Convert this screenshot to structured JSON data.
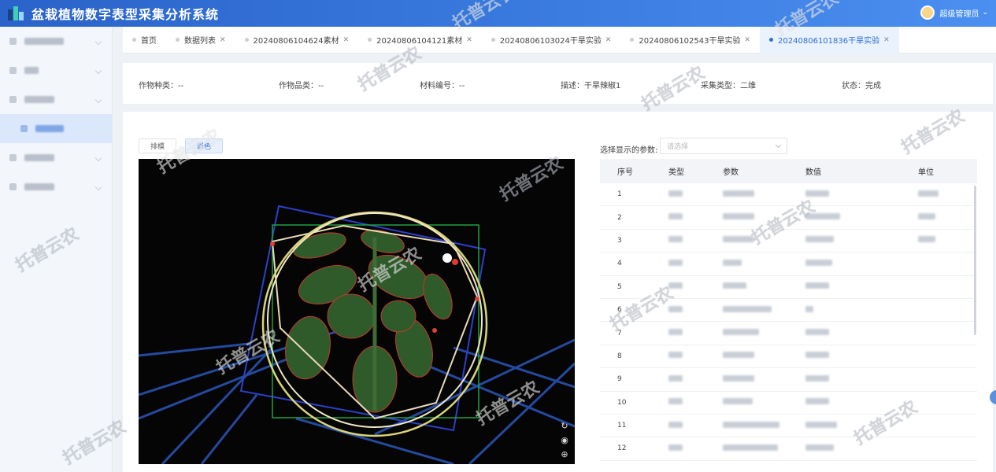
{
  "app": {
    "title": "盆栽植物数字表型采集分析系统",
    "user": "超级管理员"
  },
  "sidebar": {
    "items": [
      {
        "id": "s1",
        "w": 50
      },
      {
        "id": "s2",
        "w": 18
      },
      {
        "id": "s3",
        "w": 38
      },
      {
        "id": "s4",
        "w": 36,
        "active": true
      },
      {
        "id": "s5",
        "w": 38
      },
      {
        "id": "s6",
        "w": 38
      }
    ]
  },
  "tabs": [
    {
      "label": "首页",
      "closable": false
    },
    {
      "label": "数据列表",
      "closable": true
    },
    {
      "label": "20240806104624素材",
      "closable": true
    },
    {
      "label": "20240806104121素材",
      "closable": true
    },
    {
      "label": "20240806103024干旱实验",
      "closable": true
    },
    {
      "label": "20240806102543干旱实验",
      "closable": true
    },
    {
      "label": "20240806101836干旱实验",
      "closable": true,
      "active": true
    }
  ],
  "info": {
    "species": "作物种类：--",
    "variety": "作物品类：--",
    "material": "材料编号：--",
    "desc": "描述：干旱辣椒1",
    "type": "采集类型：二维",
    "status": "状态：完成"
  },
  "buttons": {
    "btn1": "排模",
    "btn2": "彩色"
  },
  "param": {
    "label": "选择显示的参数:",
    "placeholder": "请选择"
  },
  "table": {
    "headers": [
      "序号",
      "类型",
      "参数",
      "数值",
      "单位"
    ],
    "rows": [
      [
        "1"
      ],
      [
        "2"
      ],
      [
        "3"
      ],
      [
        "4"
      ],
      [
        "5"
      ],
      [
        "6"
      ],
      [
        "7"
      ],
      [
        "8"
      ],
      [
        "9"
      ],
      [
        "10"
      ],
      [
        "11"
      ],
      [
        "12"
      ]
    ]
  },
  "watermark": "托普云农",
  "colors": {
    "accent": "#2e6fd6",
    "header": "#3a7be0"
  }
}
